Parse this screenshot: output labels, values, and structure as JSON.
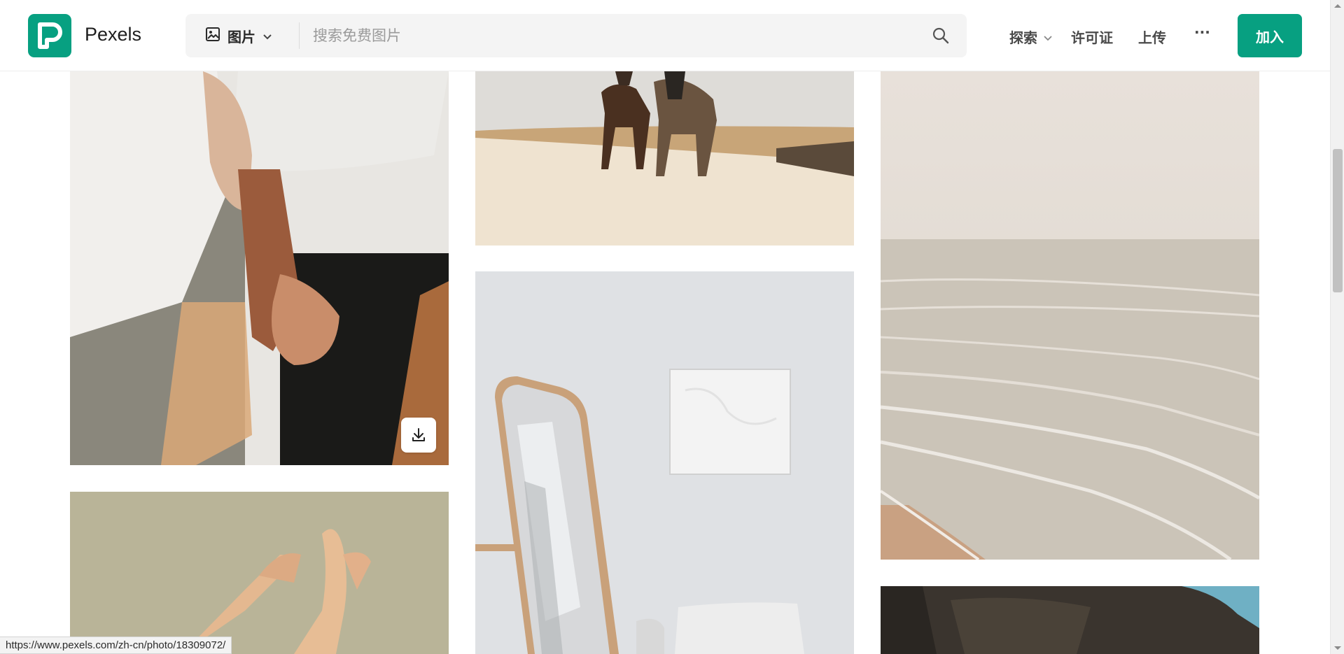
{
  "header": {
    "brand": "Pexels",
    "search": {
      "type_label": "图片",
      "placeholder": "搜索免费图片"
    },
    "nav": {
      "explore": "探索",
      "license": "许可证",
      "upload": "上传",
      "more": "···"
    },
    "join_label": "加入"
  },
  "photos": [
    {
      "id": "holding-hands",
      "subject": "couple holding hands"
    },
    {
      "id": "hands-reaching",
      "subject": "two hands reaching"
    },
    {
      "id": "horses-beach",
      "subject": "riders on horses at beach"
    },
    {
      "id": "mirror-room",
      "subject": "standing mirror and wall art"
    },
    {
      "id": "ocean-shore",
      "subject": "ocean waves on beach"
    },
    {
      "id": "cliff",
      "subject": "dark rocky cliff"
    }
  ],
  "status_bar": {
    "url": "https://www.pexels.com/zh-cn/photo/18309072/"
  },
  "colors": {
    "brand": "#07a081",
    "text": "#4a4a4a"
  },
  "icons": [
    "pexels-logo-icon",
    "image-icon",
    "chevron-down-icon",
    "search-icon",
    "download-icon"
  ]
}
